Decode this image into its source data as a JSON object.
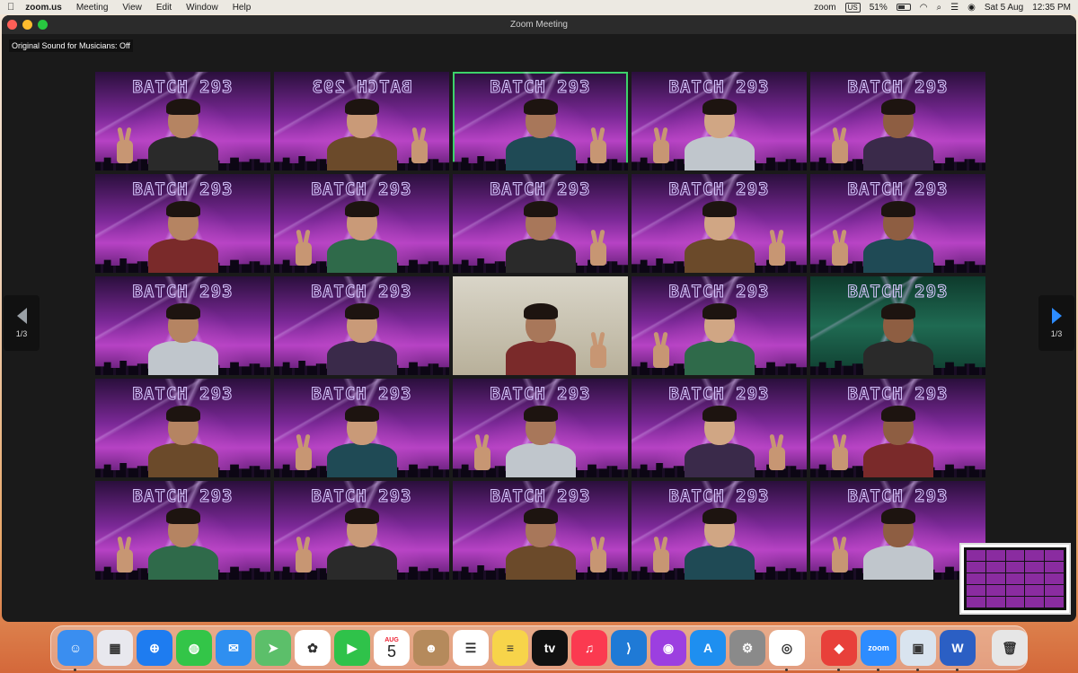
{
  "menubar": {
    "app_name": "zoom.us",
    "menus": [
      "Meeting",
      "View",
      "Edit",
      "Window",
      "Help"
    ],
    "zoom_label": "zoom",
    "input_source": "US",
    "battery": "51%",
    "date": "Sat 5 Aug",
    "time": "12:35 PM"
  },
  "window": {
    "title": "Zoom Meeting",
    "notice": "Original Sound for Musicians: Off"
  },
  "tiles": [
    {
      "bg": "purple",
      "text": "BATCH 293",
      "mirror": false,
      "hands": [
        "left"
      ]
    },
    {
      "bg": "purple",
      "text": "BATCH 293",
      "mirror": true,
      "hands": [
        "right"
      ]
    },
    {
      "bg": "purple",
      "text": "BATCH 293",
      "mirror": false,
      "hands": [
        "right"
      ],
      "active": true
    },
    {
      "bg": "purple",
      "text": "BATCH 293",
      "mirror": false,
      "hands": [
        "left"
      ]
    },
    {
      "bg": "purple",
      "text": "BATCH 293",
      "mirror": false,
      "hands": [
        "left"
      ]
    },
    {
      "bg": "purple",
      "text": "BATCH 293",
      "mirror": false,
      "hands": []
    },
    {
      "bg": "purple",
      "text": "BATCH 293",
      "mirror": false,
      "hands": [
        "left"
      ]
    },
    {
      "bg": "purple",
      "text": "BATCH 293",
      "mirror": false,
      "hands": [
        "right"
      ]
    },
    {
      "bg": "purple",
      "text": "BATCH 293",
      "mirror": false,
      "hands": [
        "right"
      ]
    },
    {
      "bg": "purple",
      "text": "BATCH 293",
      "mirror": false,
      "hands": [
        "left"
      ]
    },
    {
      "bg": "purple",
      "text": "BATCH 293",
      "mirror": false,
      "hands": []
    },
    {
      "bg": "purple",
      "text": "BATCH 293",
      "mirror": false,
      "hands": []
    },
    {
      "bg": "real",
      "text": "",
      "mirror": false,
      "hands": [
        "right"
      ]
    },
    {
      "bg": "purple",
      "text": "BATCH 293",
      "mirror": false,
      "hands": [
        "left"
      ]
    },
    {
      "bg": "green",
      "text": "BATCH 293",
      "mirror": false,
      "hands": []
    },
    {
      "bg": "purple",
      "text": "BATCH 293",
      "mirror": false,
      "hands": []
    },
    {
      "bg": "purple",
      "text": "BATCH 293",
      "mirror": false,
      "hands": [
        "left"
      ]
    },
    {
      "bg": "purple",
      "text": "BATCH 293",
      "mirror": false,
      "hands": [
        "left"
      ]
    },
    {
      "bg": "purple",
      "text": "BATCH 293",
      "mirror": false,
      "hands": [
        "right"
      ]
    },
    {
      "bg": "purple",
      "text": "BATCH 293",
      "mirror": false,
      "hands": [
        "left"
      ]
    },
    {
      "bg": "purple",
      "text": "BATCH 293",
      "mirror": false,
      "hands": [
        "left"
      ]
    },
    {
      "bg": "purple",
      "text": "BATCH 293",
      "mirror": false,
      "hands": [
        "left"
      ]
    },
    {
      "bg": "purple",
      "text": "BATCH 293",
      "mirror": false,
      "hands": [
        "right"
      ]
    },
    {
      "bg": "purple",
      "text": "BATCH 293",
      "mirror": false,
      "hands": [
        "left"
      ]
    },
    {
      "bg": "purple",
      "text": "BATCH 293",
      "mirror": false,
      "hands": [
        "left"
      ]
    }
  ],
  "pager": {
    "left_label": "1/3",
    "right_label": "1/3"
  },
  "dock": {
    "calendar_month": "AUG",
    "calendar_day": "5",
    "apps": [
      {
        "icon": "finder-icon",
        "color": "#3a8ef0",
        "glyph": "☺",
        "running": true
      },
      {
        "icon": "launchpad-icon",
        "color": "#e8e8ee",
        "glyph": "▦",
        "running": false
      },
      {
        "icon": "safari-icon",
        "color": "#1e7cf0",
        "glyph": "⊕",
        "running": false
      },
      {
        "icon": "messages-icon",
        "color": "#33c548",
        "glyph": "◍",
        "running": false
      },
      {
        "icon": "mail-icon",
        "color": "#2f8ff0",
        "glyph": "✉",
        "running": false
      },
      {
        "icon": "maps-icon",
        "color": "#5cbf6a",
        "glyph": "➤",
        "running": false
      },
      {
        "icon": "photos-icon",
        "color": "#ffffff",
        "glyph": "✿",
        "running": false
      },
      {
        "icon": "facetime-icon",
        "color": "#2fc24a",
        "glyph": "▶",
        "running": false
      },
      {
        "icon": "calendar-icon",
        "color": "#ffffff",
        "glyph": "",
        "running": false
      },
      {
        "icon": "contacts-icon",
        "color": "#b58a5c",
        "glyph": "☻",
        "running": false
      },
      {
        "icon": "reminders-icon",
        "color": "#ffffff",
        "glyph": "☰",
        "running": false
      },
      {
        "icon": "notes-icon",
        "color": "#f7d44a",
        "glyph": "≡",
        "running": false
      },
      {
        "icon": "apple-tv-icon",
        "color": "#111111",
        "glyph": "tv",
        "running": false
      },
      {
        "icon": "music-icon",
        "color": "#fb3a50",
        "glyph": "♫",
        "running": false
      },
      {
        "icon": "vscode-icon",
        "color": "#1f7ad6",
        "glyph": "⟩",
        "running": false
      },
      {
        "icon": "podcasts-icon",
        "color": "#9c3fe0",
        "glyph": "◉",
        "running": false
      },
      {
        "icon": "app-store-icon",
        "color": "#1e8ff0",
        "glyph": "A",
        "running": false
      },
      {
        "icon": "system-settings-icon",
        "color": "#8a8a8a",
        "glyph": "⚙",
        "running": false
      },
      {
        "icon": "chrome-icon",
        "color": "#ffffff",
        "glyph": "◎",
        "running": true
      }
    ],
    "apps2": [
      {
        "icon": "anydesk-icon",
        "color": "#e8403a",
        "glyph": "◆",
        "running": true
      },
      {
        "icon": "zoom-icon",
        "color": "#2d8cff",
        "glyph": "zoom",
        "running": true
      },
      {
        "icon": "preview-icon",
        "color": "#d9e4ef",
        "glyph": "▣",
        "running": true
      },
      {
        "icon": "word-icon",
        "color": "#2b5fc4",
        "glyph": "W",
        "running": true
      }
    ],
    "trash": {
      "icon": "trash-icon",
      "color": "#e6e6e6",
      "glyph": "🗑"
    }
  }
}
